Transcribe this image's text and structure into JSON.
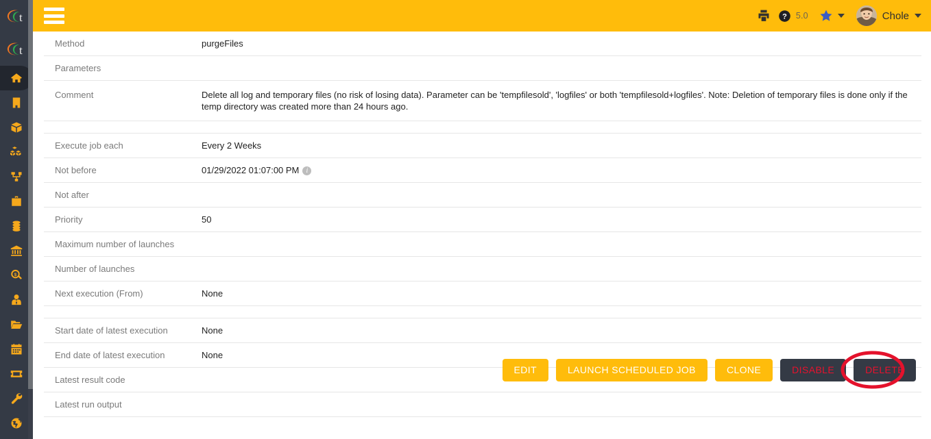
{
  "app": {
    "brand_logo_name": "logo-crescent-t",
    "accent_amber": "#ffbc0b",
    "sidebar_bg": "#343a45",
    "danger_red": "#e8112d"
  },
  "topbar": {
    "menu_label": "Menu",
    "print_icon": "printer-icon",
    "help_icon": "question-circle-icon",
    "version": "5.0",
    "star_icon": "star-icon",
    "star_chevron": "chevron-down-icon",
    "user_name": "Chole",
    "user_chevron": "chevron-down-icon",
    "avatar_name": "avatar"
  },
  "sidebar": {
    "items": [
      {
        "name": "sidebar-item-home",
        "icon": "home-icon",
        "active": true
      },
      {
        "name": "sidebar-item-building",
        "icon": "building-icon",
        "active": false
      },
      {
        "name": "sidebar-item-product",
        "icon": "box-icon",
        "active": false
      },
      {
        "name": "sidebar-item-products",
        "icon": "boxes-icon",
        "active": false
      },
      {
        "name": "sidebar-item-structure",
        "icon": "sitemap-icon",
        "active": false
      },
      {
        "name": "sidebar-item-business",
        "icon": "briefcase-icon",
        "active": false
      },
      {
        "name": "sidebar-item-finance",
        "icon": "coins-icon",
        "active": false
      },
      {
        "name": "sidebar-item-bank",
        "icon": "bank-icon",
        "active": false
      },
      {
        "name": "sidebar-item-audit",
        "icon": "search-dollar-icon",
        "active": false
      },
      {
        "name": "sidebar-item-hr",
        "icon": "user-tie-icon",
        "active": false
      },
      {
        "name": "sidebar-item-documents",
        "icon": "folder-open-icon",
        "active": false
      },
      {
        "name": "sidebar-item-agenda",
        "icon": "calendar-icon",
        "active": false
      },
      {
        "name": "sidebar-item-tickets",
        "icon": "ticket-icon",
        "active": false
      },
      {
        "name": "sidebar-item-tools",
        "icon": "wrench-icon",
        "active": false
      },
      {
        "name": "sidebar-item-website",
        "icon": "globe-icon",
        "active": false
      }
    ]
  },
  "detail": {
    "rows": [
      {
        "label": "Method",
        "value": "purgeFiles",
        "info": false
      },
      {
        "label": "Parameters",
        "value": "",
        "info": false
      },
      {
        "label": "Comment",
        "value": "Delete all log and temporary files (no risk of losing data). Parameter can be 'tempfilesold', 'logfiles' or both 'tempfilesold+logfiles'. Note: Deletion of temporary files is done only if the temp directory was created more than 24 hours ago.",
        "info": false
      },
      {
        "label": "Execute job each",
        "value": "Every 2 Weeks",
        "info": false
      },
      {
        "label": "Not before",
        "value": "01/29/2022 01:07:00 PM",
        "info": true
      },
      {
        "label": "Not after",
        "value": "",
        "info": false
      },
      {
        "label": "Priority",
        "value": "50",
        "info": false
      },
      {
        "label": "Maximum number of launches",
        "value": "",
        "info": false
      },
      {
        "label": "Number of launches",
        "value": "",
        "info": false
      },
      {
        "label": "Next execution (From)",
        "value": "None",
        "info": false
      },
      {
        "label": "Start date of latest execution",
        "value": "None",
        "info": false
      },
      {
        "label": "End date of latest execution",
        "value": "None",
        "info": false
      },
      {
        "label": "Latest result code",
        "value": "",
        "info": false
      },
      {
        "label": "Latest run output",
        "value": "",
        "info": false
      }
    ],
    "info_glyph": "i"
  },
  "actions": {
    "edit": "EDIT",
    "launch": "LAUNCH SCHEDULED JOB",
    "clone": "CLONE",
    "disable": "DISABLE",
    "delete": "DELETE",
    "annotation": "red-ellipse-highlight"
  }
}
